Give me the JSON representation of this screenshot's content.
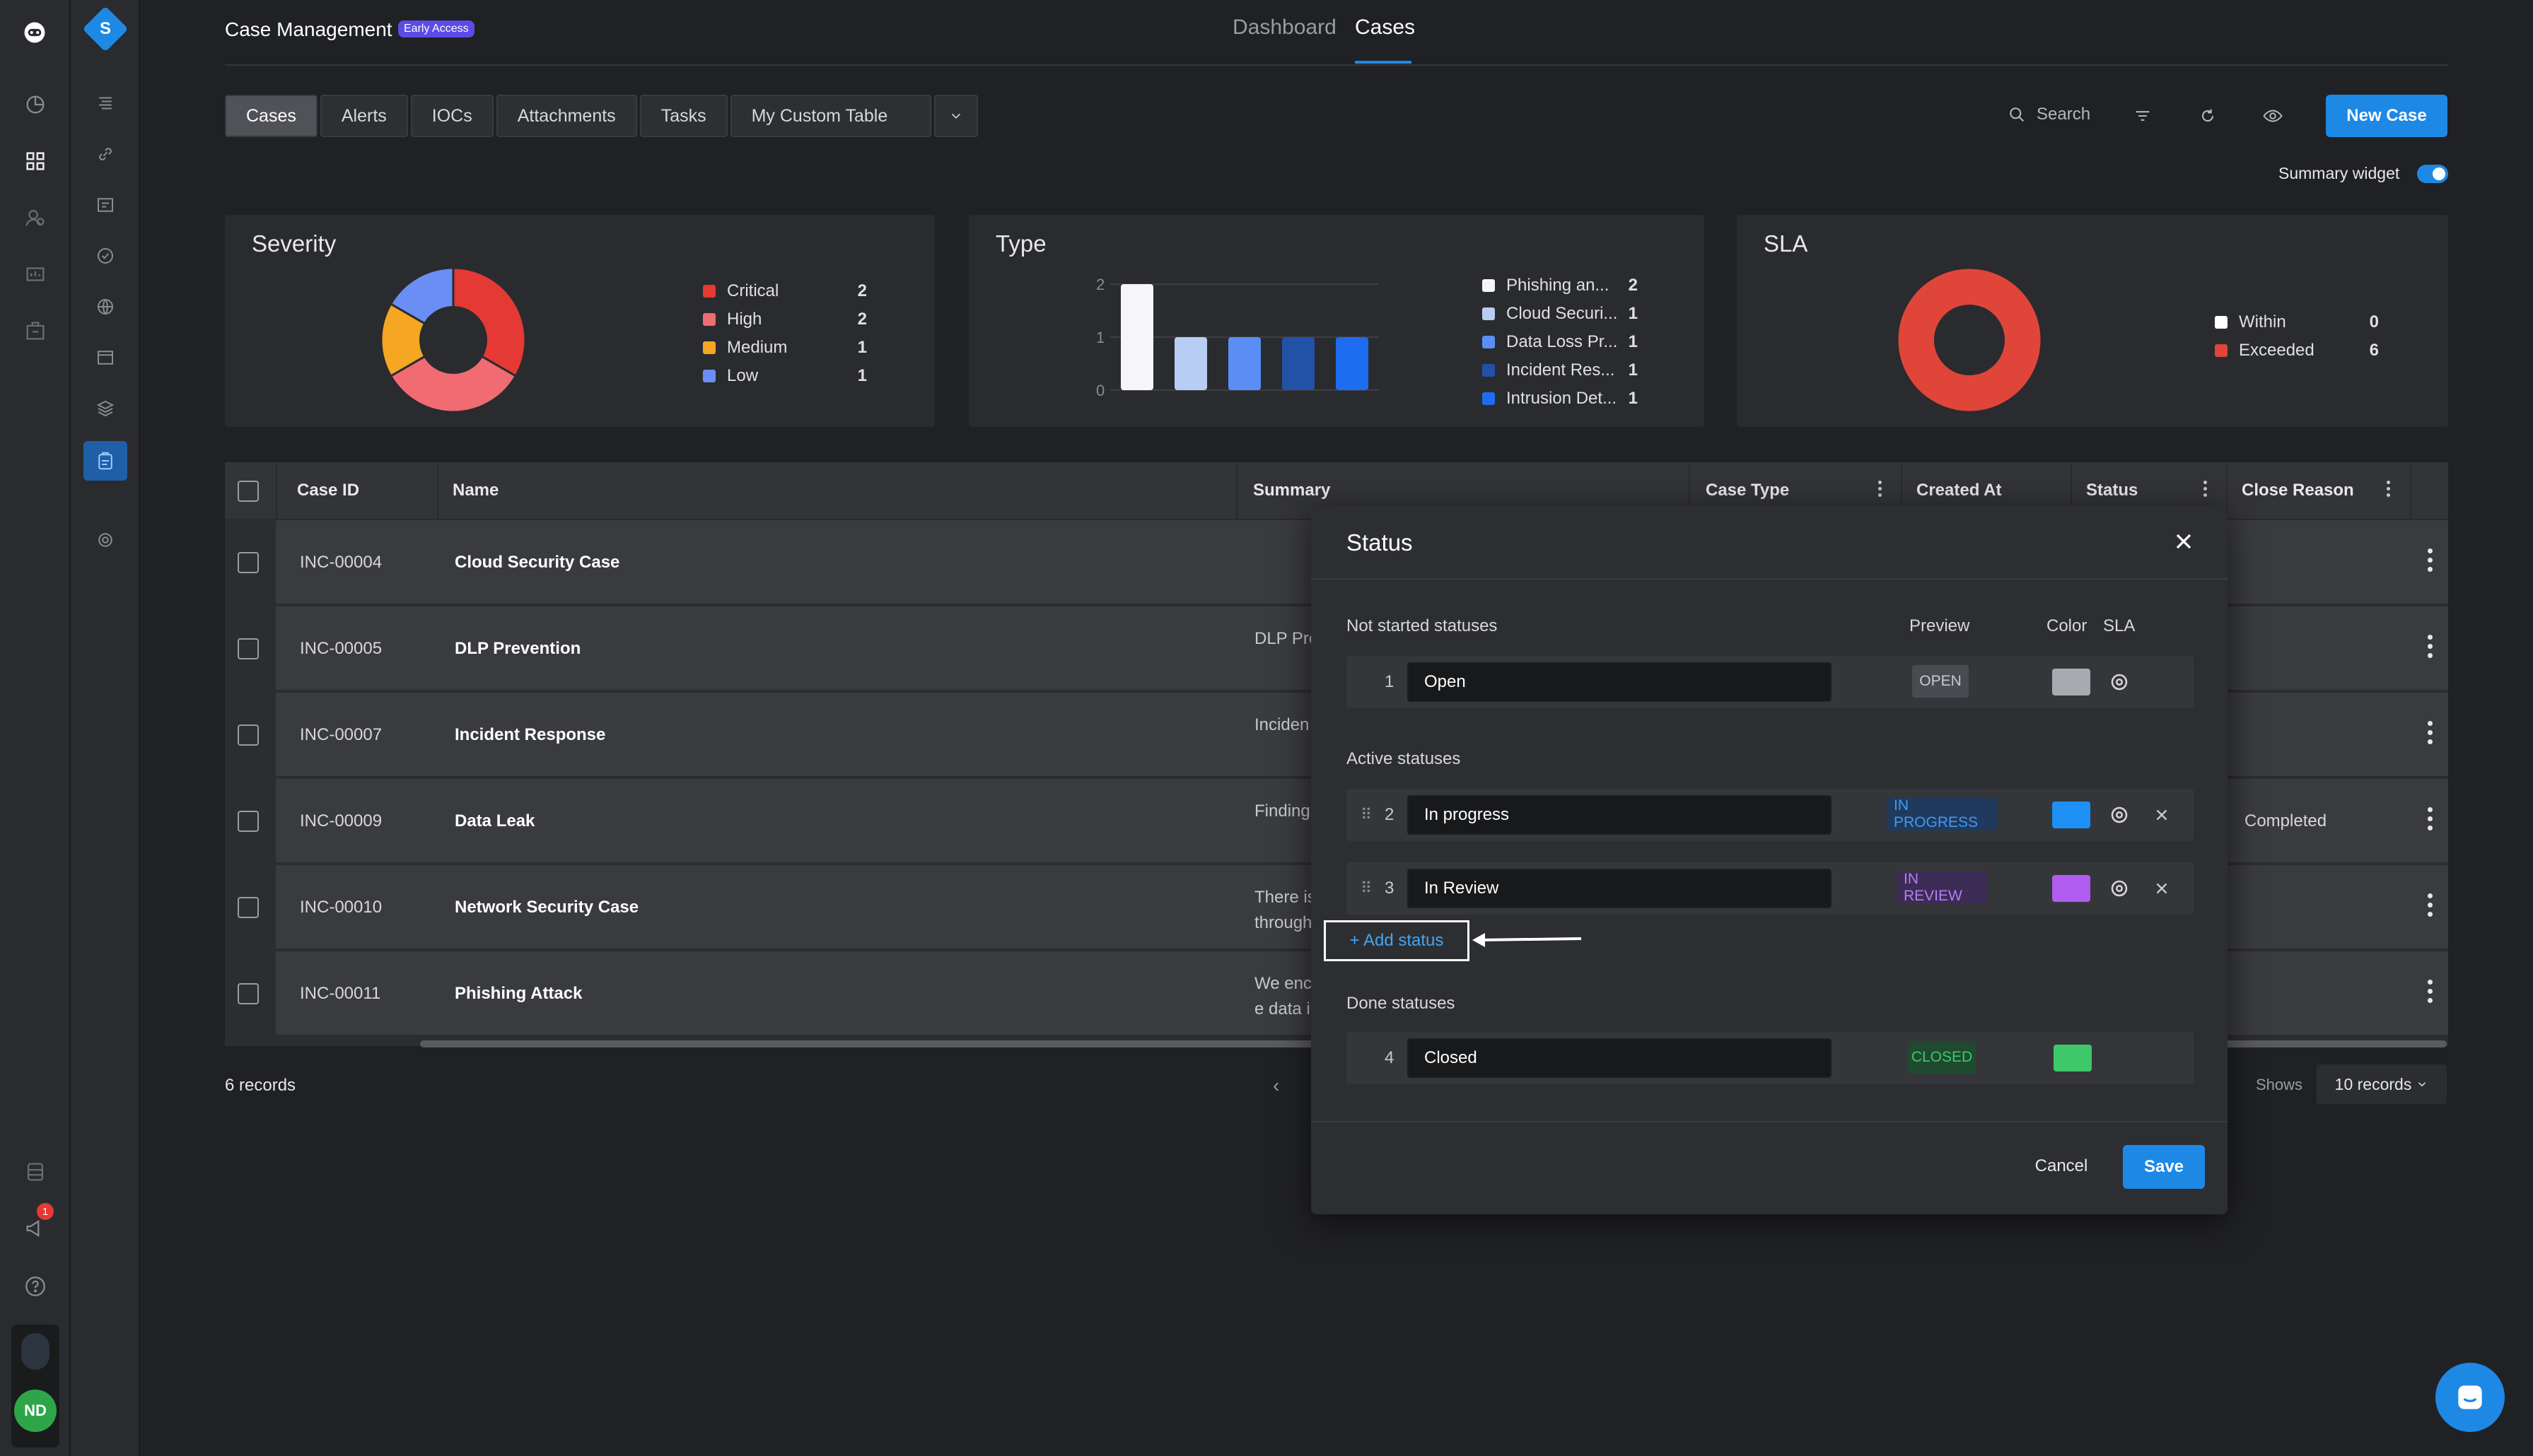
{
  "app": {
    "title": "Case Management",
    "badge": "Early Access",
    "logo_letter": "S"
  },
  "nav": {
    "dashboard": "Dashboard",
    "cases": "Cases"
  },
  "tabs": [
    "Cases",
    "Alerts",
    "IOCs",
    "Attachments",
    "Tasks",
    "My Custom Table"
  ],
  "toolbar": {
    "search_label": "Search",
    "new_case": "New Case",
    "summary_widget": "Summary widget"
  },
  "widgets": {
    "severity": {
      "title": "Severity",
      "legend": [
        {
          "label": "Critical",
          "value": "2",
          "color": "#e53935"
        },
        {
          "label": "High",
          "value": "2",
          "color": "#f06b72"
        },
        {
          "label": "Medium",
          "value": "1",
          "color": "#f5a623"
        },
        {
          "label": "Low",
          "value": "1",
          "color": "#6b8ef5"
        }
      ]
    },
    "type": {
      "title": "Type",
      "legend": [
        {
          "label": "Phishing an...",
          "value": "2",
          "color": "#f5f5fa"
        },
        {
          "label": "Cloud Securi...",
          "value": "1",
          "color": "#b8cdf3"
        },
        {
          "label": "Data Loss Pr...",
          "value": "1",
          "color": "#5b8ef5"
        },
        {
          "label": "Incident Res...",
          "value": "1",
          "color": "#2251a8"
        },
        {
          "label": "Intrusion Det...",
          "value": "1",
          "color": "#1e6cf0"
        }
      ]
    },
    "sla": {
      "title": "SLA",
      "legend": [
        {
          "label": "Within",
          "value": "0",
          "color": "#ffffff"
        },
        {
          "label": "Exceeded",
          "value": "6",
          "color": "#e0453a"
        }
      ]
    }
  },
  "chart_data": [
    {
      "type": "pie",
      "title": "Severity",
      "categories": [
        "Critical",
        "High",
        "Medium",
        "Low"
      ],
      "values": [
        2,
        2,
        1,
        1
      ]
    },
    {
      "type": "bar",
      "title": "Type",
      "categories": [
        "Phishing an...",
        "Cloud Securi...",
        "Data Loss Pr...",
        "Incident Res...",
        "Intrusion Det..."
      ],
      "values": [
        2,
        1,
        1,
        1,
        1
      ],
      "ylim": [
        0,
        2
      ],
      "yticks": [
        "0",
        "1",
        "2"
      ]
    },
    {
      "type": "pie",
      "title": "SLA",
      "categories": [
        "Within",
        "Exceeded"
      ],
      "values": [
        0,
        6
      ]
    }
  ],
  "table": {
    "headers": [
      "Case ID",
      "Name",
      "Summary",
      "Case Type",
      "Created At",
      "Status",
      "Close Reason"
    ],
    "rows": [
      {
        "id": "INC-00004",
        "name": "Cloud Security Case",
        "summary": [
          "",
          ""
        ],
        "close_reason": ""
      },
      {
        "id": "INC-00005",
        "name": "DLP Prevention",
        "summary": [
          "DLP Pre",
          ""
        ],
        "close_reason": ""
      },
      {
        "id": "INC-00007",
        "name": "Incident Response",
        "summary": [
          "Inciden",
          ""
        ],
        "close_reason": ""
      },
      {
        "id": "INC-00009",
        "name": "Data Leak",
        "summary": [
          "Finding",
          ""
        ],
        "close_reason": "Completed"
      },
      {
        "id": "INC-00010",
        "name": "Network Security Case",
        "summary": [
          "There is",
          "through"
        ],
        "close_reason": ""
      },
      {
        "id": "INC-00011",
        "name": "Phishing Attack",
        "summary": [
          "We enc",
          "e data i"
        ],
        "close_reason": ""
      }
    ],
    "records": "6 records",
    "shows_label": "Shows",
    "per_page": "10 records"
  },
  "modal": {
    "title": "Status",
    "columns": {
      "preview": "Preview",
      "color": "Color",
      "sla": "SLA"
    },
    "sections": {
      "not_started": "Not started statuses",
      "active": "Active statuses",
      "done": "Done statuses"
    },
    "statuses": [
      {
        "num": "1",
        "name": "Open",
        "preview": "OPEN",
        "color": "#a8aab0"
      },
      {
        "num": "2",
        "name": "In progress",
        "preview": "IN PROGRESS",
        "color": "#1e90f5"
      },
      {
        "num": "3",
        "name": "In Review",
        "preview": "IN REVIEW",
        "color": "#b15cf0"
      },
      {
        "num": "4",
        "name": "Closed",
        "preview": "CLOSED",
        "color": "#3ec86a"
      }
    ],
    "add_status": "+ Add status",
    "cancel": "Cancel",
    "save": "Save"
  },
  "sidebar": {
    "notification_count": "1",
    "user_initials": "ND"
  }
}
